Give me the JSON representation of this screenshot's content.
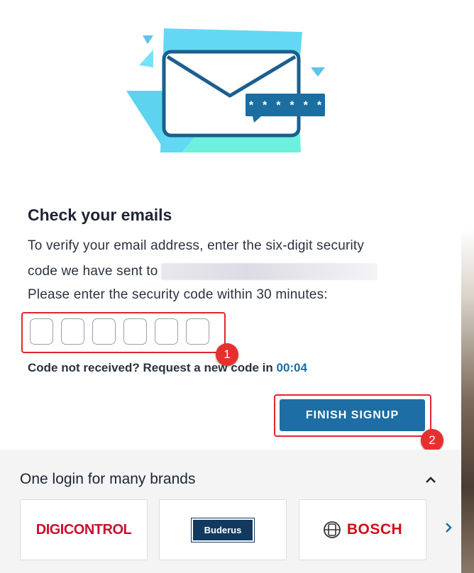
{
  "illustration": {
    "icon": "envelope-with-password-bubble",
    "bubble_text": "* * * * * *"
  },
  "heading": "Check your emails",
  "instructions": {
    "line1": "To verify your email address, enter the six-digit security",
    "line2_prefix": "code we have sent to",
    "line3": "Please enter the security code within 30 minutes:"
  },
  "code_inputs": [
    "",
    "",
    "",
    "",
    "",
    ""
  ],
  "resend": {
    "text": "Code not received? Request a new code in",
    "timer": "00:04"
  },
  "annotations": {
    "badge1": "1",
    "badge2": "2"
  },
  "finish_button": "FINISH SIGNUP",
  "brands": {
    "title": "One login for many brands",
    "items": [
      {
        "name": "DIGICONTROL"
      },
      {
        "name": "Buderus"
      },
      {
        "name": "BOSCH"
      }
    ]
  },
  "colors": {
    "primary": "#1c6ea4",
    "annotation": "#e0262e",
    "panel": "#f4f4f4"
  }
}
